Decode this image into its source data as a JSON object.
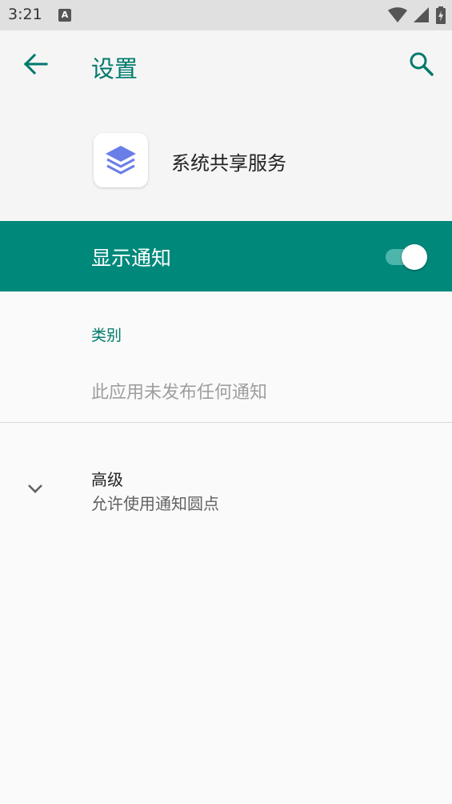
{
  "status_bar": {
    "time": "3:21",
    "notification_letter": "A",
    "battery_icon": "battery-charging-icon",
    "wifi_icon": "wifi-icon",
    "signal_icon": "signal-icon"
  },
  "app_bar": {
    "title": "设置",
    "back_icon": "arrow-back-icon",
    "search_icon": "search-icon"
  },
  "app_info": {
    "name": "系统共享服务",
    "icon": "layers-app-icon"
  },
  "master_toggle": {
    "label": "显示通知",
    "enabled": true
  },
  "categories": {
    "header": "类别",
    "empty_message": "此应用未发布任何通知"
  },
  "advanced": {
    "title": "高级",
    "summary": "允许使用通知圆点"
  },
  "colors": {
    "accent": "#00796b",
    "master_bar": "#00897b",
    "switch_track": "#4db6ac",
    "background": "#fafafa"
  }
}
